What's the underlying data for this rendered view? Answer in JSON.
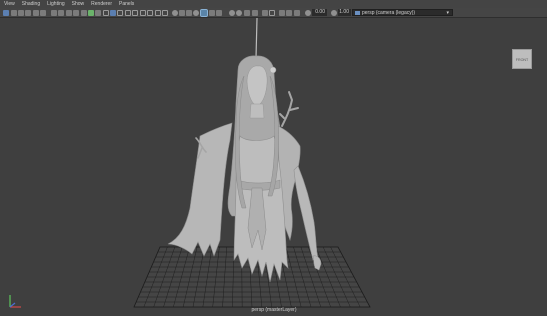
{
  "menubar": {
    "items": [
      "View",
      "Shading",
      "Lighting",
      "Show",
      "Renderer",
      "Panels"
    ]
  },
  "toolbar": {
    "value_field_1": "0.00",
    "value_field_2": "1.00",
    "camera_select": "persp (camera (legacy))"
  },
  "viewport": {
    "viewcube_label": "FRONT",
    "layer_label": "persp (masterLayer)"
  },
  "icons": [
    "select-icon",
    "lasso-icon",
    "move-icon",
    "rotate-icon",
    "scale-icon",
    "grid-icon",
    "camera-icon",
    "axis-gizmo-icon"
  ],
  "colors": {
    "viewport_bg": "#3f3f3f",
    "menubar_bg": "#444444",
    "toolbar_bg": "#454545",
    "model": "#b5b5b5",
    "grid": "#1c1c1c",
    "axis_x": "#d24a4a",
    "axis_y": "#5cc75c",
    "axis_z": "#4a6fd2"
  }
}
